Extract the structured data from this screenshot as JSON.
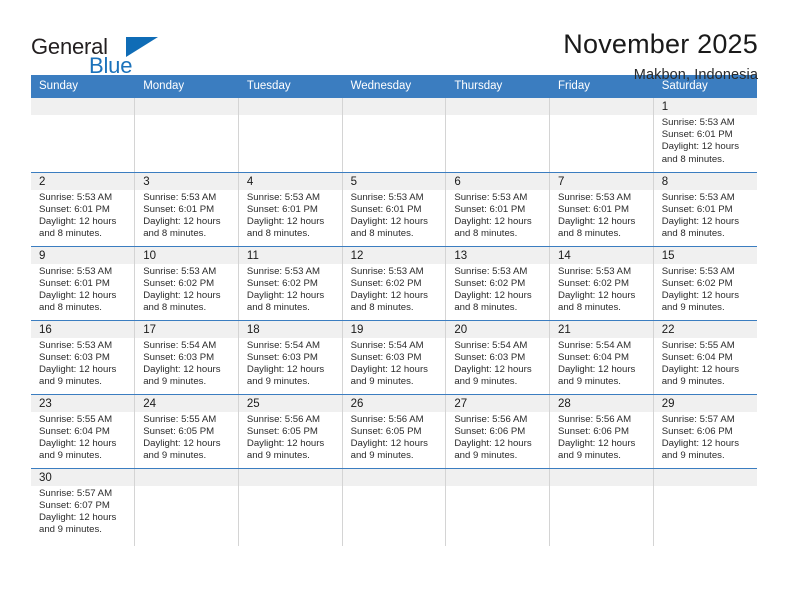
{
  "logo": {
    "word_one": "General",
    "word_two": "Blue",
    "flag_icon": "blue-triangle-flag-icon",
    "accent_color": "#1b72bb"
  },
  "header": {
    "title": "November 2025",
    "subtitle": "Makbon, Indonesia"
  },
  "theme": {
    "header_blue": "#3b7dc0",
    "daynum_gray": "#f0f0f0",
    "row_divider": "#3b7dc0"
  },
  "calendar": {
    "weekday_headers": [
      "Sunday",
      "Monday",
      "Tuesday",
      "Wednesday",
      "Thursday",
      "Friday",
      "Saturday"
    ],
    "weeks": [
      [
        {
          "day": "",
          "lines": []
        },
        {
          "day": "",
          "lines": []
        },
        {
          "day": "",
          "lines": []
        },
        {
          "day": "",
          "lines": []
        },
        {
          "day": "",
          "lines": []
        },
        {
          "day": "",
          "lines": []
        },
        {
          "day": "1",
          "lines": [
            "Sunrise: 5:53 AM",
            "Sunset: 6:01 PM",
            "Daylight: 12 hours",
            "and 8 minutes."
          ]
        }
      ],
      [
        {
          "day": "2",
          "lines": [
            "Sunrise: 5:53 AM",
            "Sunset: 6:01 PM",
            "Daylight: 12 hours",
            "and 8 minutes."
          ]
        },
        {
          "day": "3",
          "lines": [
            "Sunrise: 5:53 AM",
            "Sunset: 6:01 PM",
            "Daylight: 12 hours",
            "and 8 minutes."
          ]
        },
        {
          "day": "4",
          "lines": [
            "Sunrise: 5:53 AM",
            "Sunset: 6:01 PM",
            "Daylight: 12 hours",
            "and 8 minutes."
          ]
        },
        {
          "day": "5",
          "lines": [
            "Sunrise: 5:53 AM",
            "Sunset: 6:01 PM",
            "Daylight: 12 hours",
            "and 8 minutes."
          ]
        },
        {
          "day": "6",
          "lines": [
            "Sunrise: 5:53 AM",
            "Sunset: 6:01 PM",
            "Daylight: 12 hours",
            "and 8 minutes."
          ]
        },
        {
          "day": "7",
          "lines": [
            "Sunrise: 5:53 AM",
            "Sunset: 6:01 PM",
            "Daylight: 12 hours",
            "and 8 minutes."
          ]
        },
        {
          "day": "8",
          "lines": [
            "Sunrise: 5:53 AM",
            "Sunset: 6:01 PM",
            "Daylight: 12 hours",
            "and 8 minutes."
          ]
        }
      ],
      [
        {
          "day": "9",
          "lines": [
            "Sunrise: 5:53 AM",
            "Sunset: 6:01 PM",
            "Daylight: 12 hours",
            "and 8 minutes."
          ]
        },
        {
          "day": "10",
          "lines": [
            "Sunrise: 5:53 AM",
            "Sunset: 6:02 PM",
            "Daylight: 12 hours",
            "and 8 minutes."
          ]
        },
        {
          "day": "11",
          "lines": [
            "Sunrise: 5:53 AM",
            "Sunset: 6:02 PM",
            "Daylight: 12 hours",
            "and 8 minutes."
          ]
        },
        {
          "day": "12",
          "lines": [
            "Sunrise: 5:53 AM",
            "Sunset: 6:02 PM",
            "Daylight: 12 hours",
            "and 8 minutes."
          ]
        },
        {
          "day": "13",
          "lines": [
            "Sunrise: 5:53 AM",
            "Sunset: 6:02 PM",
            "Daylight: 12 hours",
            "and 8 minutes."
          ]
        },
        {
          "day": "14",
          "lines": [
            "Sunrise: 5:53 AM",
            "Sunset: 6:02 PM",
            "Daylight: 12 hours",
            "and 8 minutes."
          ]
        },
        {
          "day": "15",
          "lines": [
            "Sunrise: 5:53 AM",
            "Sunset: 6:02 PM",
            "Daylight: 12 hours",
            "and 9 minutes."
          ]
        }
      ],
      [
        {
          "day": "16",
          "lines": [
            "Sunrise: 5:53 AM",
            "Sunset: 6:03 PM",
            "Daylight: 12 hours",
            "and 9 minutes."
          ]
        },
        {
          "day": "17",
          "lines": [
            "Sunrise: 5:54 AM",
            "Sunset: 6:03 PM",
            "Daylight: 12 hours",
            "and 9 minutes."
          ]
        },
        {
          "day": "18",
          "lines": [
            "Sunrise: 5:54 AM",
            "Sunset: 6:03 PM",
            "Daylight: 12 hours",
            "and 9 minutes."
          ]
        },
        {
          "day": "19",
          "lines": [
            "Sunrise: 5:54 AM",
            "Sunset: 6:03 PM",
            "Daylight: 12 hours",
            "and 9 minutes."
          ]
        },
        {
          "day": "20",
          "lines": [
            "Sunrise: 5:54 AM",
            "Sunset: 6:03 PM",
            "Daylight: 12 hours",
            "and 9 minutes."
          ]
        },
        {
          "day": "21",
          "lines": [
            "Sunrise: 5:54 AM",
            "Sunset: 6:04 PM",
            "Daylight: 12 hours",
            "and 9 minutes."
          ]
        },
        {
          "day": "22",
          "lines": [
            "Sunrise: 5:55 AM",
            "Sunset: 6:04 PM",
            "Daylight: 12 hours",
            "and 9 minutes."
          ]
        }
      ],
      [
        {
          "day": "23",
          "lines": [
            "Sunrise: 5:55 AM",
            "Sunset: 6:04 PM",
            "Daylight: 12 hours",
            "and 9 minutes."
          ]
        },
        {
          "day": "24",
          "lines": [
            "Sunrise: 5:55 AM",
            "Sunset: 6:05 PM",
            "Daylight: 12 hours",
            "and 9 minutes."
          ]
        },
        {
          "day": "25",
          "lines": [
            "Sunrise: 5:56 AM",
            "Sunset: 6:05 PM",
            "Daylight: 12 hours",
            "and 9 minutes."
          ]
        },
        {
          "day": "26",
          "lines": [
            "Sunrise: 5:56 AM",
            "Sunset: 6:05 PM",
            "Daylight: 12 hours",
            "and 9 minutes."
          ]
        },
        {
          "day": "27",
          "lines": [
            "Sunrise: 5:56 AM",
            "Sunset: 6:06 PM",
            "Daylight: 12 hours",
            "and 9 minutes."
          ]
        },
        {
          "day": "28",
          "lines": [
            "Sunrise: 5:56 AM",
            "Sunset: 6:06 PM",
            "Daylight: 12 hours",
            "and 9 minutes."
          ]
        },
        {
          "day": "29",
          "lines": [
            "Sunrise: 5:57 AM",
            "Sunset: 6:06 PM",
            "Daylight: 12 hours",
            "and 9 minutes."
          ]
        }
      ],
      [
        {
          "day": "30",
          "lines": [
            "Sunrise: 5:57 AM",
            "Sunset: 6:07 PM",
            "Daylight: 12 hours",
            "and 9 minutes."
          ]
        },
        {
          "day": "",
          "lines": []
        },
        {
          "day": "",
          "lines": []
        },
        {
          "day": "",
          "lines": []
        },
        {
          "day": "",
          "lines": []
        },
        {
          "day": "",
          "lines": []
        },
        {
          "day": "",
          "lines": []
        }
      ]
    ]
  }
}
